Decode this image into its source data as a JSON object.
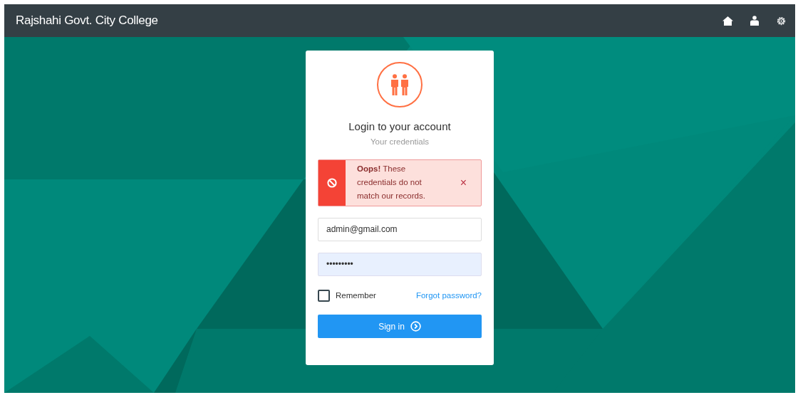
{
  "navbar": {
    "title": "Rajshahi Govt. City College"
  },
  "login": {
    "heading": "Login to your account",
    "subheading": "Your credentials",
    "alert": {
      "strong": "Oops!",
      "message": "These credentials do not match our records.",
      "close": "×"
    },
    "email": {
      "value": "admin@gmail.com"
    },
    "password": {
      "value": "•••••••••"
    },
    "remember": {
      "label": "Remember",
      "checked": false
    },
    "forgot_link": "Forgot password?",
    "submit": "Sign in"
  }
}
